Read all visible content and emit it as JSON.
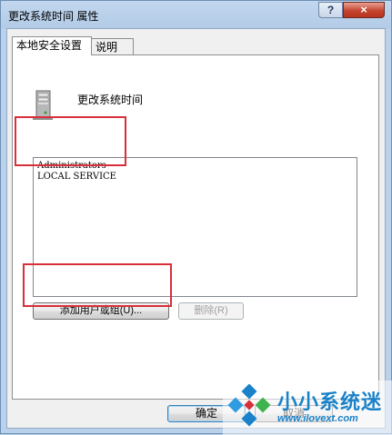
{
  "window": {
    "title": "更改系统时间 属性",
    "help_label": "?",
    "close_label": "×"
  },
  "tabs": [
    {
      "label": "本地安全设置",
      "active": true
    },
    {
      "label": "说明",
      "active": false
    }
  ],
  "policy": {
    "icon": "server-icon",
    "name": "更改系统时间"
  },
  "members": [
    "Administrators",
    "LOCAL SERVICE"
  ],
  "buttons": {
    "add": "添加用户或组(U)...",
    "remove": "删除(R)",
    "ok": "确定",
    "cancel": "取消"
  },
  "watermark": {
    "name": "小小系统迷",
    "url": "www.ilovext.com"
  },
  "colors": {
    "highlight": "#d7303a",
    "watermark": "#1a82c8"
  }
}
